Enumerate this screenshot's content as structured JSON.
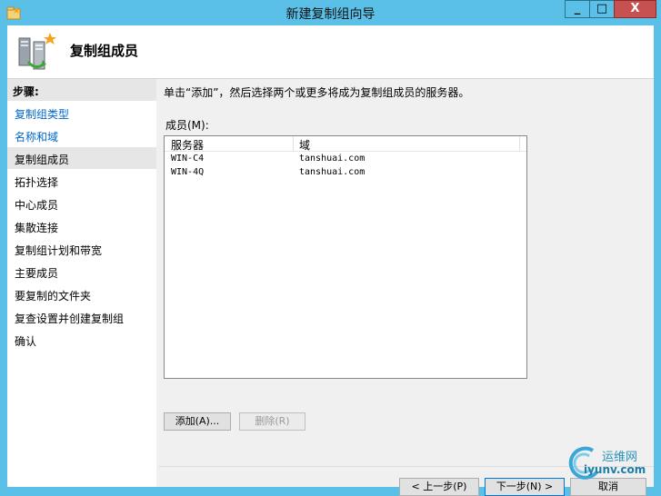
{
  "window": {
    "title": "新建复制组向导",
    "min_glyph": "_",
    "max_glyph": "□",
    "close_glyph": "X"
  },
  "header": {
    "title": "复制组成员"
  },
  "steps": {
    "title": "步骤:",
    "items": [
      {
        "label": "复制组类型",
        "state": "link"
      },
      {
        "label": "名称和域",
        "state": "link"
      },
      {
        "label": "复制组成员",
        "state": "current"
      },
      {
        "label": "拓扑选择",
        "state": "normal"
      },
      {
        "label": "中心成员",
        "state": "normal"
      },
      {
        "label": "集散连接",
        "state": "normal"
      },
      {
        "label": "复制组计划和带宽",
        "state": "normal"
      },
      {
        "label": "主要成员",
        "state": "normal"
      },
      {
        "label": "要复制的文件夹",
        "state": "normal"
      },
      {
        "label": "复查设置并创建复制组",
        "state": "normal"
      },
      {
        "label": "确认",
        "state": "normal"
      }
    ]
  },
  "content": {
    "instruction": "单击“添加”，然后选择两个或更多将成为复制组成员的服务器。",
    "members_label": "成员(M):",
    "columns": [
      "服务器",
      "域"
    ],
    "rows": [
      {
        "server": "WIN-C4",
        "domain": "tanshuai.com"
      },
      {
        "server": "WIN-4Q",
        "domain": "tanshuai.com"
      }
    ],
    "add_button": "添加(A)...",
    "remove_button": "删除(R)"
  },
  "footer": {
    "back_button": "< 上一步(P)",
    "next_button": "下一步(N) >",
    "cancel_button": "取消"
  },
  "watermark": {
    "line1": "运维网",
    "line2": "iyunv.com"
  }
}
